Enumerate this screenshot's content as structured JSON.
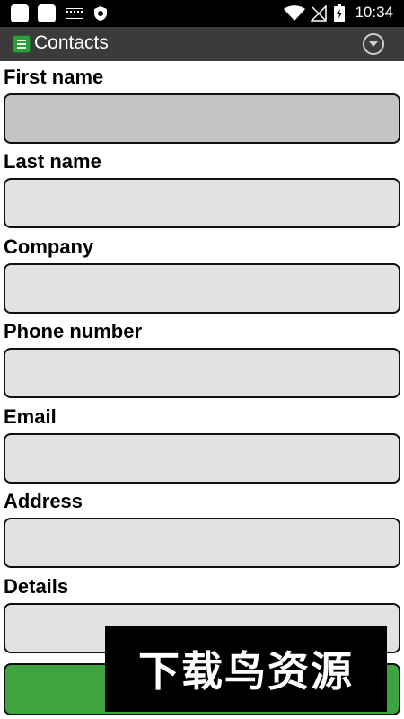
{
  "status_bar": {
    "time": "10:34",
    "icons": [
      "app-square-icon",
      "app-square-icon",
      "keyboard-icon",
      "shield-icon",
      "wifi-icon",
      "no-signal-icon",
      "battery-charging-icon"
    ]
  },
  "action_bar": {
    "title": "Contacts",
    "app_icon": "notepad-icon",
    "menu_icon": "chevron-down-circle-icon"
  },
  "form": {
    "fields": [
      {
        "label": "First name",
        "value": "",
        "placeholder": ""
      },
      {
        "label": "Last name",
        "value": "",
        "placeholder": ""
      },
      {
        "label": "Company",
        "value": "",
        "placeholder": ""
      },
      {
        "label": "Phone number",
        "value": "",
        "placeholder": ""
      },
      {
        "label": "Email",
        "value": "",
        "placeholder": ""
      },
      {
        "label": "Address",
        "value": "",
        "placeholder": ""
      },
      {
        "label": "Details",
        "value": "",
        "placeholder": ""
      }
    ]
  },
  "submit_button": {
    "label": ""
  },
  "watermark": {
    "text": "下载鸟资源"
  },
  "colors": {
    "action_bar": "#3b3b3b",
    "field_bg": "#e2e2e2",
    "field_focused_bg": "#c4c4c4",
    "button_green": "#3fa33f"
  }
}
